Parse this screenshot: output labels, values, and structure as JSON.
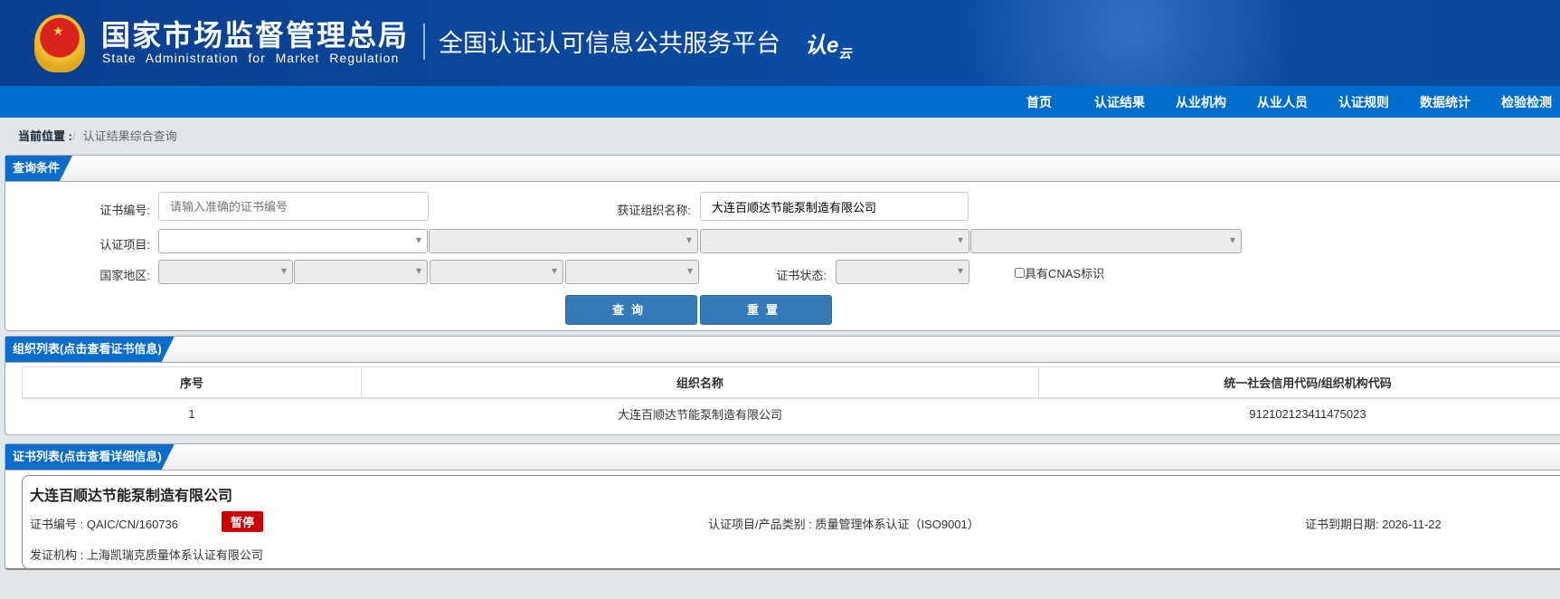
{
  "header": {
    "agency_cn": "国家市场监督管理总局",
    "agency_en": "State Administration  for  Market Regulation",
    "platform": "全国认证认可信息公共服务平台",
    "logo_text": "认e云"
  },
  "nav": [
    "首页",
    "认证结果",
    "从业机构",
    "从业人员",
    "认证规则",
    "数据统计",
    "检验检测"
  ],
  "breadcrumb": {
    "label": "当前位置 : ",
    "link": "认证结果",
    "sep": "/",
    "current": "认证结果综合查询"
  },
  "query": {
    "title": "查询条件",
    "cert_no_label": "证书编号:",
    "cert_no_placeholder": "请输入准确的证书编号",
    "cert_no_value": "",
    "org_label": "获证组织名称:",
    "org_value": "大连百顺达节能泵制造有限公司",
    "project_label": "认证项目:",
    "region_label": "国家地区:",
    "status_label": "证书状态:",
    "cnas_label": "具有CNAS标识",
    "cnas_checked": false,
    "search_button": "查询",
    "reset_button": "重置"
  },
  "org_list": {
    "title": "组织列表(点击查看证书信息)",
    "columns": [
      "序号",
      "组织名称",
      "统一社会信用代码/组织机构代码"
    ],
    "rows": [
      [
        "1",
        "大连百顺达节能泵制造有限公司",
        "912102123411475023"
      ]
    ]
  },
  "cert_list": {
    "title": "证书列表(点击查看详细信息)",
    "cards": [
      {
        "org": "大连百顺达节能泵制造有限公司",
        "cert_no": "证书编号 : QAIC/CN/160736",
        "status": "暂停",
        "status_color": "#cc0000",
        "project": "认证项目/产品类别 : 质量管理体系认证（ISO9001）",
        "expiry": "证书到期日期: 2026-11-22",
        "issuer": "发证机构 : 上海凯瑞克质量体系认证有限公司"
      }
    ]
  }
}
